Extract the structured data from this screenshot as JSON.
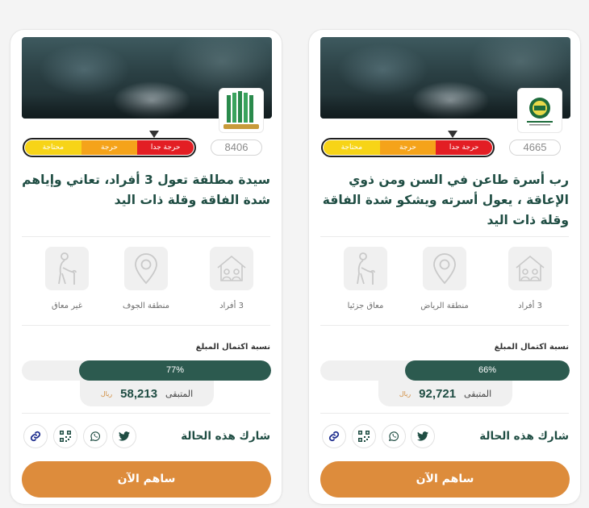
{
  "colors": {
    "primary_green": "#2c5a4f",
    "title_green": "#1f4d43",
    "donate_orange": "#dd8c3c",
    "need_critical": "#e31e24",
    "need_medium": "#f5a31a",
    "need_low": "#f7d417"
  },
  "cards": [
    {
      "count": "4665",
      "need_levels": [
        "حرجة جدا",
        "حرجة",
        "محتاجة"
      ],
      "need_level_selected": "حرجة جدا",
      "title": "رب أسرة طاعن في السن ومن ذوي الإعاقة ، يعول أسرته ويشكو شدة الفاقة وقلة ذات اليد",
      "features": [
        {
          "icon": "house-family-icon",
          "label": "3 أفراد"
        },
        {
          "icon": "location-pin-icon",
          "label": "منطقة الرياض"
        },
        {
          "icon": "elderly-cane-icon",
          "label": "معاق جزئيا"
        }
      ],
      "completion_label": "نسبة اكتمال المبلغ",
      "completion_percent": 66,
      "completion_text": "66%",
      "remaining_label": "المتبقى",
      "remaining_value": "92,721",
      "currency": "ريال",
      "share_title": "شارك هذه الحالة",
      "share_icons": [
        "twitter-icon",
        "whatsapp-icon",
        "qr-code-icon",
        "link-icon"
      ],
      "donate_label": "ساهم الآن"
    },
    {
      "count": "8406",
      "need_levels": [
        "حرجة جدا",
        "حرجة",
        "محتاجة"
      ],
      "need_level_selected": "حرجة جدا",
      "title": "سيدة مطلقة تعول 3 أفراد، تعاني وإياهم شدة الفاقة وقلة ذات اليد",
      "features": [
        {
          "icon": "house-family-icon",
          "label": "3 أفراد"
        },
        {
          "icon": "location-pin-icon",
          "label": "منطقة الجوف"
        },
        {
          "icon": "elderly-cane-icon",
          "label": "غير معاق"
        }
      ],
      "completion_label": "نسبة اكتمال المبلغ",
      "completion_percent": 77,
      "completion_text": "77%",
      "remaining_label": "المتبقى",
      "remaining_value": "58,213",
      "currency": "ريال",
      "share_title": "شارك هذه الحالة",
      "share_icons": [
        "twitter-icon",
        "whatsapp-icon",
        "qr-code-icon",
        "link-icon"
      ],
      "donate_label": "ساهم الآن"
    }
  ]
}
